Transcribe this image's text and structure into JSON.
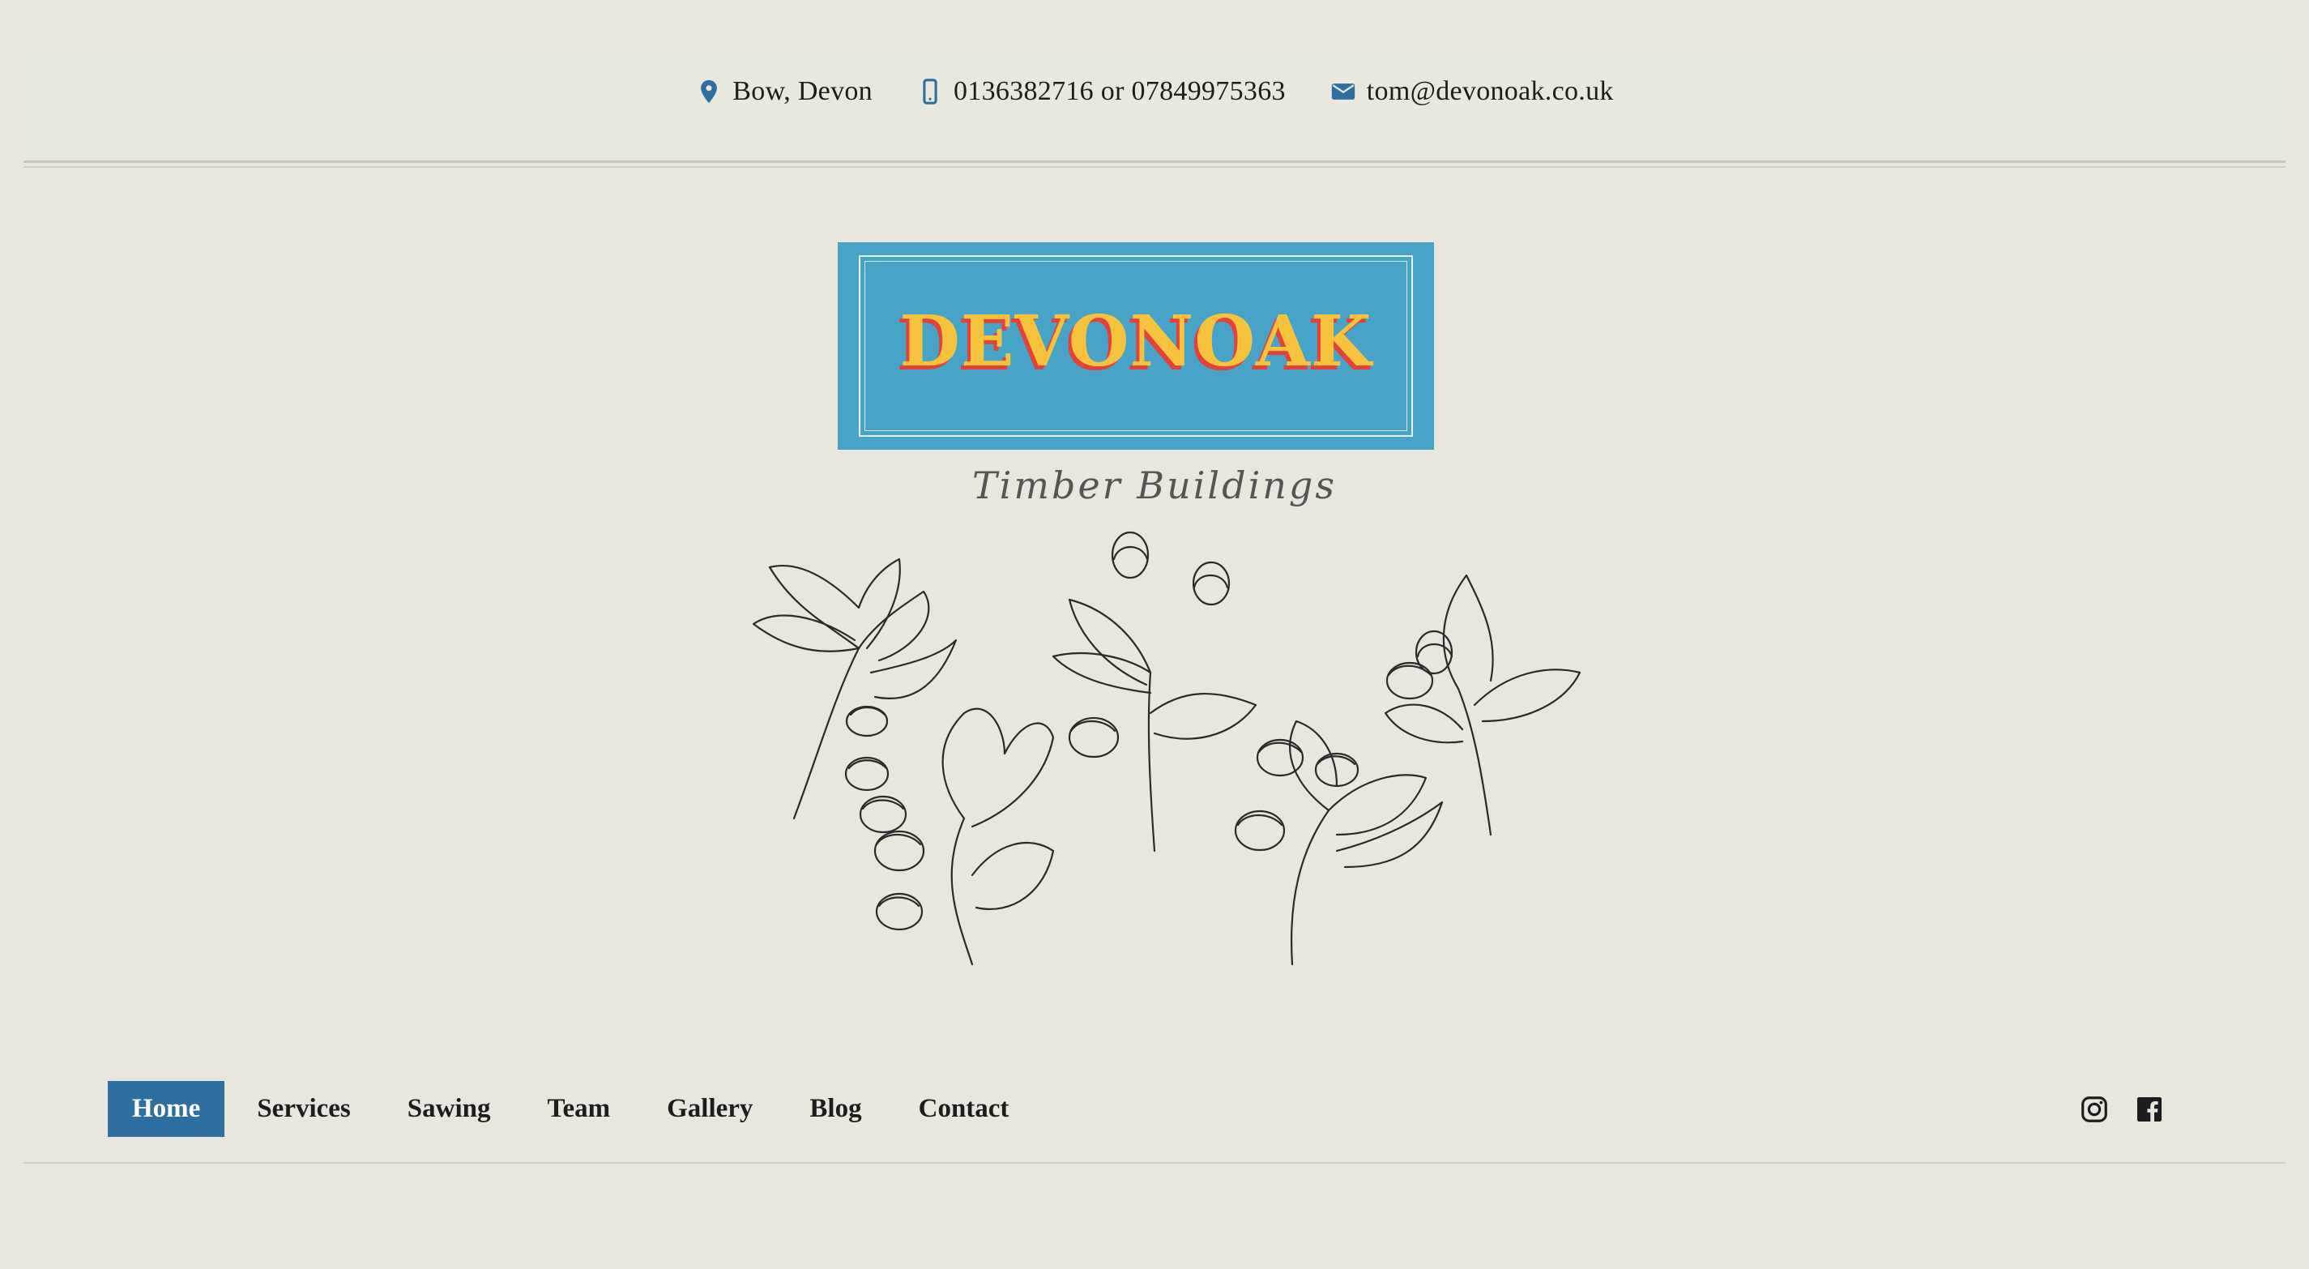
{
  "contact": {
    "location": "Bow, Devon",
    "phone": "0136382716 or 07849975363",
    "email": "tom@devonoak.co.uk",
    "icons": [
      "location-pin-icon",
      "mobile-phone-icon",
      "envelope-icon"
    ],
    "icon_color": "#2c6fa0"
  },
  "logo": {
    "name": "DEVONOAK",
    "tagline": "Timber Buildings",
    "background": "#48a3c9",
    "text_color": "#f7c33c",
    "shadow_color": "#e5413b"
  },
  "illustration": {
    "icon": "oak-leaves-acorns-illustration"
  },
  "nav": {
    "items": [
      {
        "label": "Home",
        "active": true
      },
      {
        "label": "Services"
      },
      {
        "label": "Sawing"
      },
      {
        "label": "Team"
      },
      {
        "label": "Gallery"
      },
      {
        "label": "Blog"
      },
      {
        "label": "Contact"
      }
    ],
    "active_color": "#2c6fa0"
  },
  "social": {
    "icons": [
      "instagram-icon",
      "facebook-icon"
    ]
  },
  "colors": {
    "page_background": "#e9e7dd"
  }
}
